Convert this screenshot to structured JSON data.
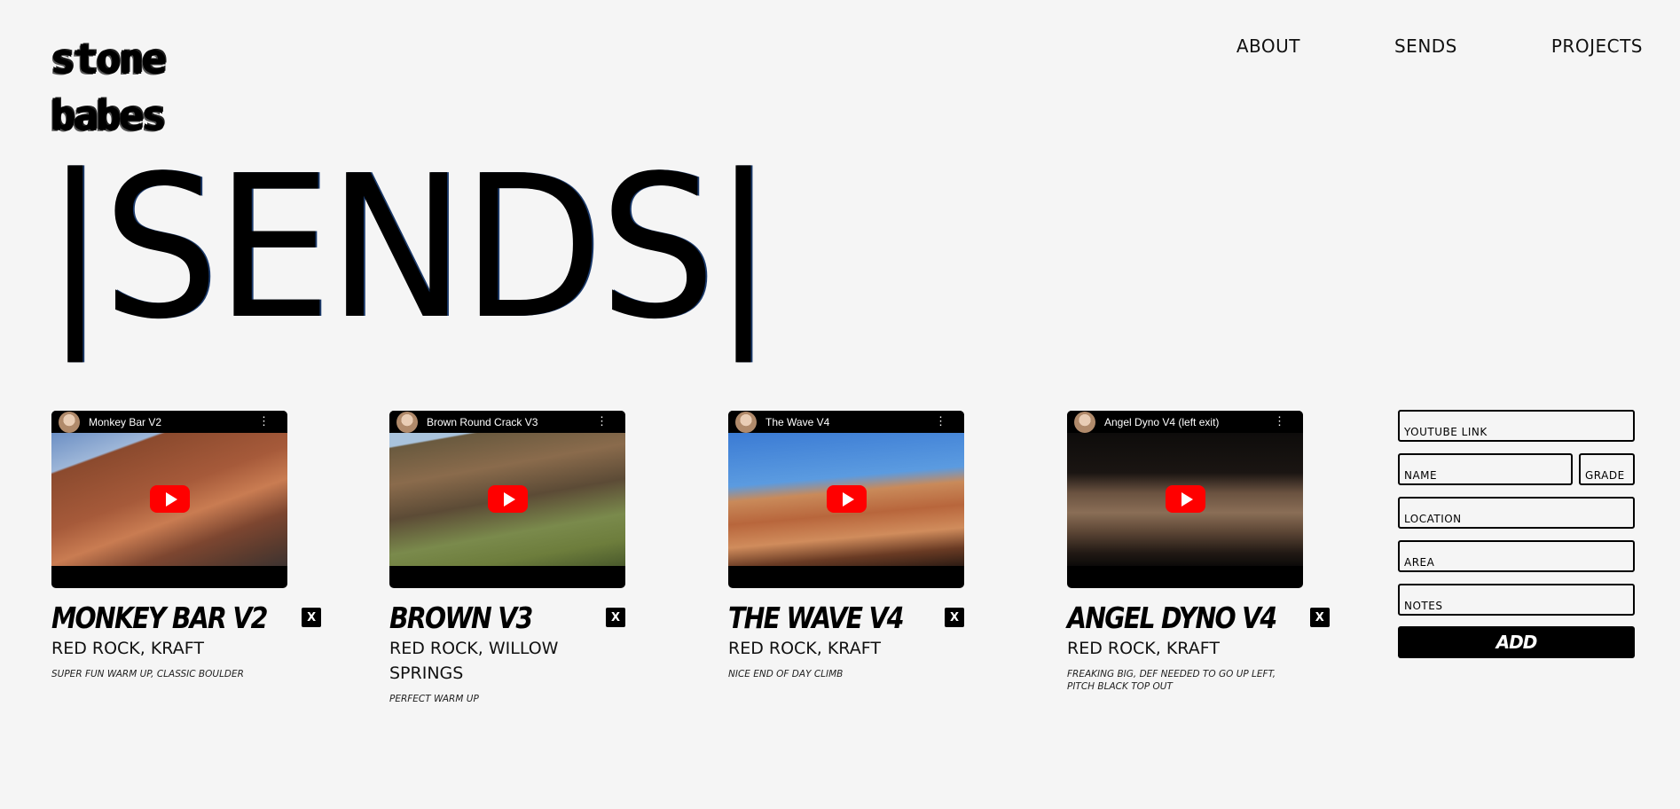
{
  "logo": {
    "line1": "stone",
    "line2": "babes"
  },
  "nav": {
    "items": [
      {
        "label": "ABOUT"
      },
      {
        "label": "SENDS"
      },
      {
        "label": "PROJECTS"
      }
    ]
  },
  "heading": "|SENDS|",
  "sends": [
    {
      "video_title": "Monkey Bar V2",
      "title": "MONKEY BAR V2",
      "location": "RED ROCK, KRAFT",
      "notes": "SUPER FUN WARM UP, CLASSIC BOULDER",
      "close_label": "X"
    },
    {
      "video_title": "Brown Round Crack V3",
      "title": "BROWN V3",
      "location": "RED ROCK, WILLOW SPRINGS",
      "notes": "PERFECT WARM UP",
      "close_label": "X"
    },
    {
      "video_title": "The Wave V4",
      "title": "THE WAVE V4",
      "location": "RED ROCK, KRAFT",
      "notes": "NICE END OF DAY CLIMB",
      "close_label": "X"
    },
    {
      "video_title": "Angel Dyno V4 (left exit)",
      "title": "ANGEL DYNO V4",
      "location": "RED ROCK, KRAFT",
      "notes": "FREAKING BIG, DEF NEEDED TO GO UP LEFT, PITCH BLACK TOP OUT",
      "close_label": "X"
    }
  ],
  "form": {
    "youtube_link": "YOUTUBE LINK",
    "name": "NAME",
    "grade": "GRADE",
    "location": "LOCATION",
    "area": "AREA",
    "notes": "NOTES",
    "add_label": "ADD"
  },
  "icons": {
    "play": "play-icon",
    "more": "more-vertical-icon",
    "close": "close-icon"
  },
  "colors": {
    "background": "#f5f5f5",
    "text": "#000000",
    "youtube_red": "#ff0000"
  }
}
